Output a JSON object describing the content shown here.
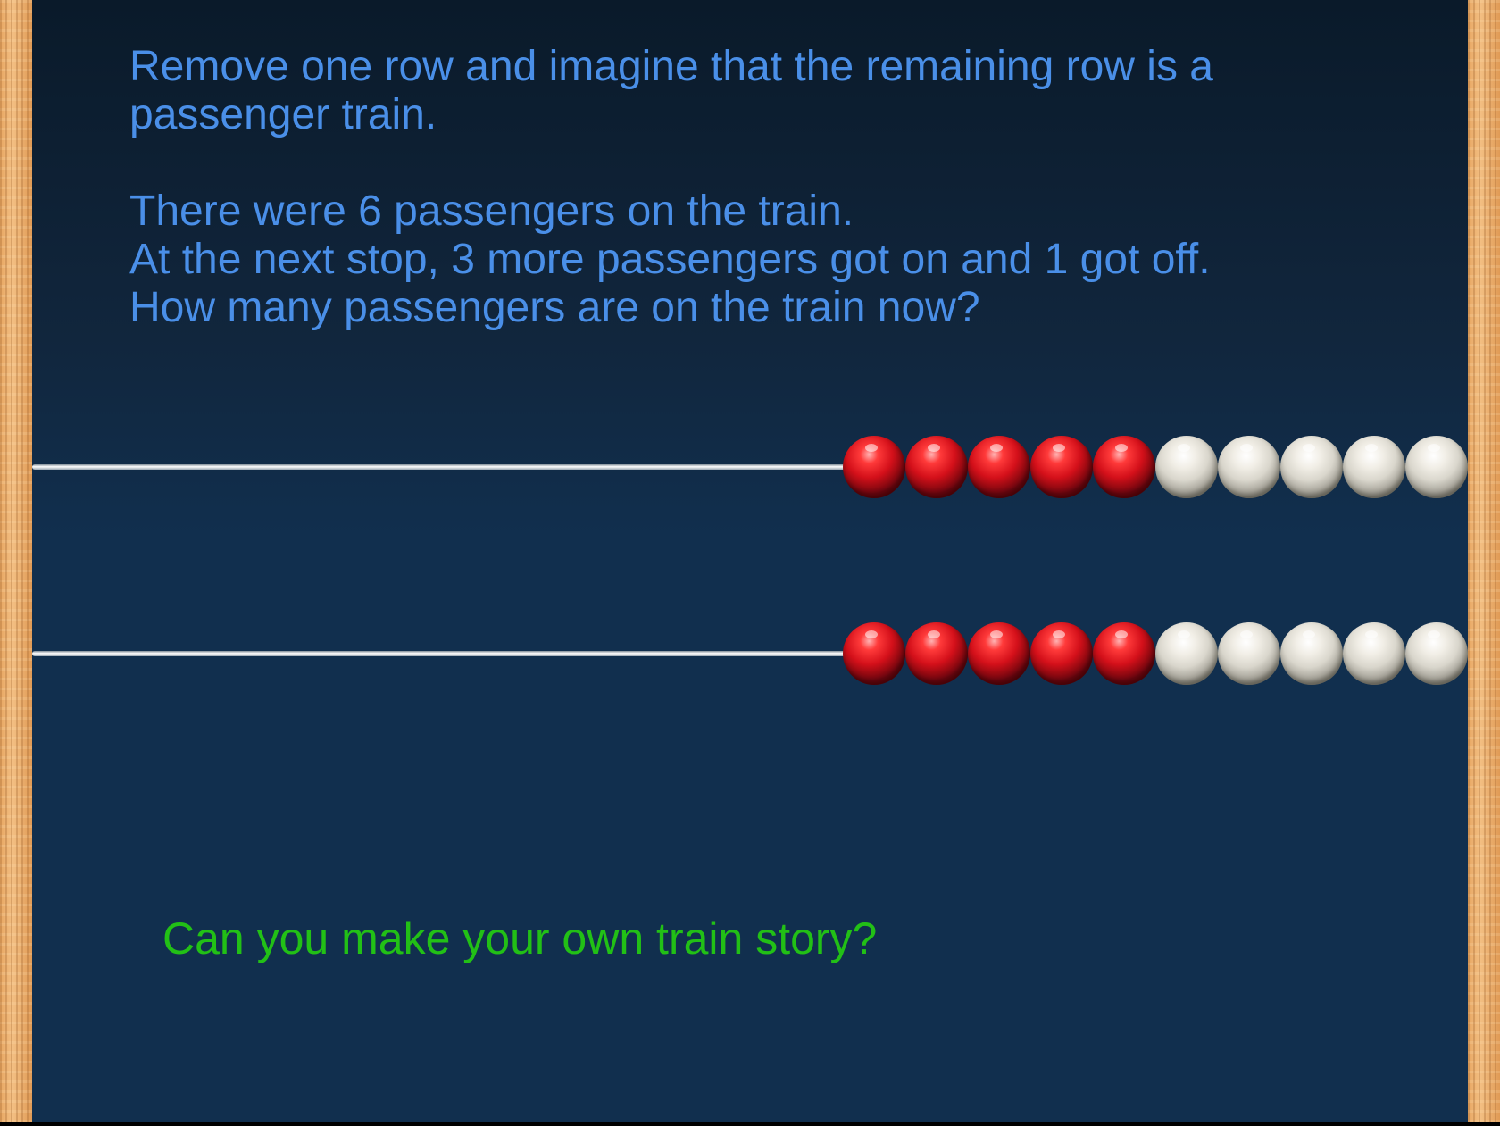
{
  "prompt": {
    "line1": "Remove one row and imagine that the remaining row is a",
    "line2": "passenger train.",
    "line3": "There were 6 passengers on the train.",
    "line4": "At the next stop, 3 more passengers got on and 1 got off.",
    "line5": "How many passengers are on the train now?"
  },
  "question": "Can you make your own train story?",
  "rekenrek": {
    "rows": [
      {
        "red_beads": 5,
        "white_beads": 5
      },
      {
        "red_beads": 5,
        "white_beads": 5
      }
    ]
  },
  "colors": {
    "prompt_text": "#4a8fe8",
    "question_text": "#22c016",
    "background": "#112f4e",
    "bead_red": "#d4101a",
    "bead_white": "#f1eee6",
    "frame_wood": "#f3bf82"
  }
}
